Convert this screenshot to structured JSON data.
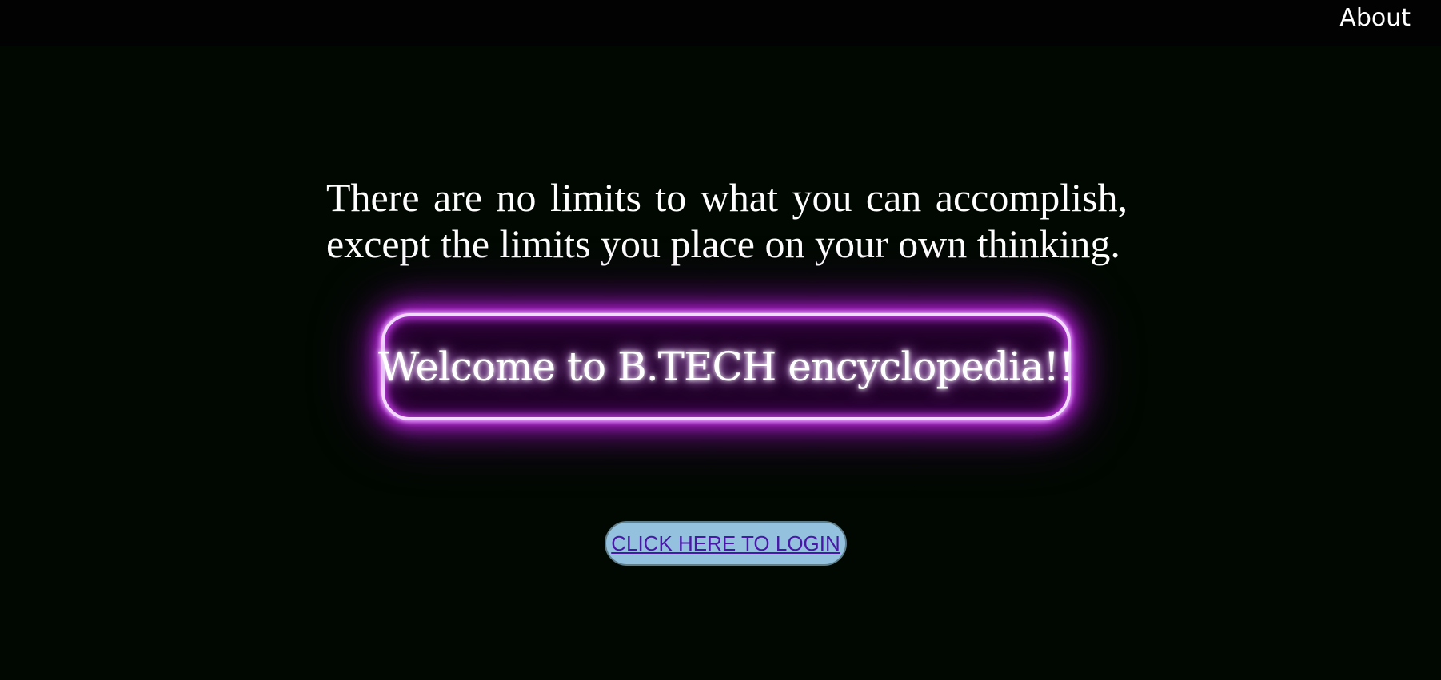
{
  "header": {
    "about_label": "About"
  },
  "main": {
    "quote": "There are no limits to what you can accomplish, except the limits you place on your own thinking.",
    "welcome_title": "Welcome to B.TECH encyclopedia!!",
    "login_label": "CLICK HERE TO LOGIN"
  },
  "colors": {
    "page_background": "#010801",
    "topbar_background": "#020202",
    "neon_glow": "#b323d6",
    "login_button_background": "#94c1de",
    "login_link_text": "#4a18a8"
  }
}
